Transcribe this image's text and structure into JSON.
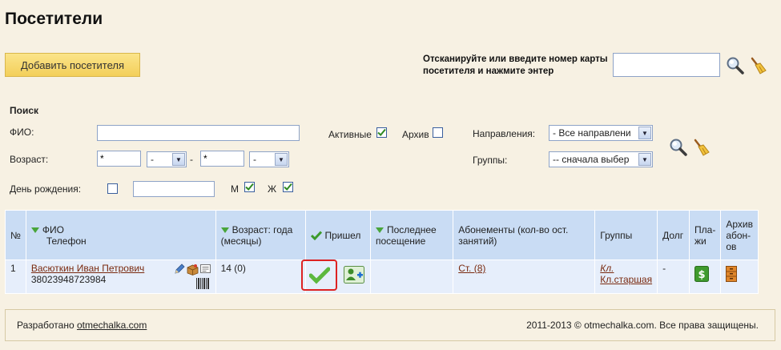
{
  "page_title": "Посетители",
  "add_button": "Добавить посетителя",
  "scan": {
    "line1": "Отсканируйте или введите номер карты",
    "line2": "посетителя и нажмите энтер",
    "value": ""
  },
  "search": {
    "title": "Поиск",
    "fio_label": "ФИО:",
    "fio_value": "",
    "age_label": "Возраст:",
    "age_from": "*",
    "age_from_unit": "-",
    "age_dash": "-",
    "age_to": "*",
    "age_to_unit": "-",
    "birthday_label": "День рождения:",
    "birthday_value": "",
    "male_label": "М",
    "female_label": "Ж",
    "active_label": "Активные",
    "archive_label": "Архив",
    "directions_label": "Направления:",
    "directions_value": "- Все направлени",
    "groups_label": "Группы:",
    "groups_value": "-- сначала выбер"
  },
  "table": {
    "headers": {
      "num": "№",
      "fio": "ФИО",
      "phone": "Телефон",
      "age": "Возраст: года (месяцы)",
      "came": "Пришел",
      "last_visit": "Последнее посещение",
      "subscriptions": "Абонементы (кол-во ост. занятий)",
      "groups": "Группы",
      "debt": "Долг",
      "payments": "Пла-жи",
      "archive": "Архив абон-ов"
    },
    "rows": [
      {
        "num": "1",
        "name": "Васюткин Иван Петрович",
        "phone": "38023948723984",
        "age": "14 (0)",
        "last_visit": "",
        "subscription": "Ст. (8)",
        "group1": "Кл.",
        "group2": "Кл.старшая",
        "debt": "-"
      }
    ]
  },
  "footer": {
    "left_prefix": "Разработано ",
    "left_link": "otmechalka.com",
    "right": "2011-2013 © otmechalka.com. Все права защищены."
  },
  "colors": {
    "header_bg": "#c9dcf4",
    "row_bg": "#e6eefb",
    "page_bg": "#f7f1e3",
    "accent": "#49a53b",
    "button": "#f3cf5a"
  }
}
